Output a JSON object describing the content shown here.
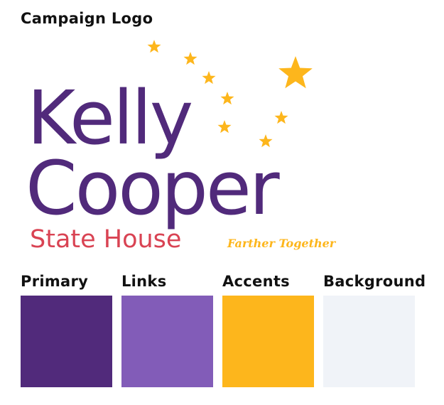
{
  "section_title": "Campaign Logo",
  "logo": {
    "first_name": "Kelly",
    "last_name": "Cooper",
    "office": "State House",
    "tagline": "Farther Together",
    "name_color": "#512a7b",
    "office_color": "#d94353",
    "star_color": "#fdb61c",
    "tagline_color": "#fdb61c",
    "star_icon": "star-icon"
  },
  "palette": [
    {
      "label": "Primary",
      "color": "#512a7b"
    },
    {
      "label": "Links",
      "color": "#825cb8"
    },
    {
      "label": "Accents",
      "color": "#fdb61c"
    },
    {
      "label": "Background",
      "color": "#f0f3f8"
    }
  ]
}
